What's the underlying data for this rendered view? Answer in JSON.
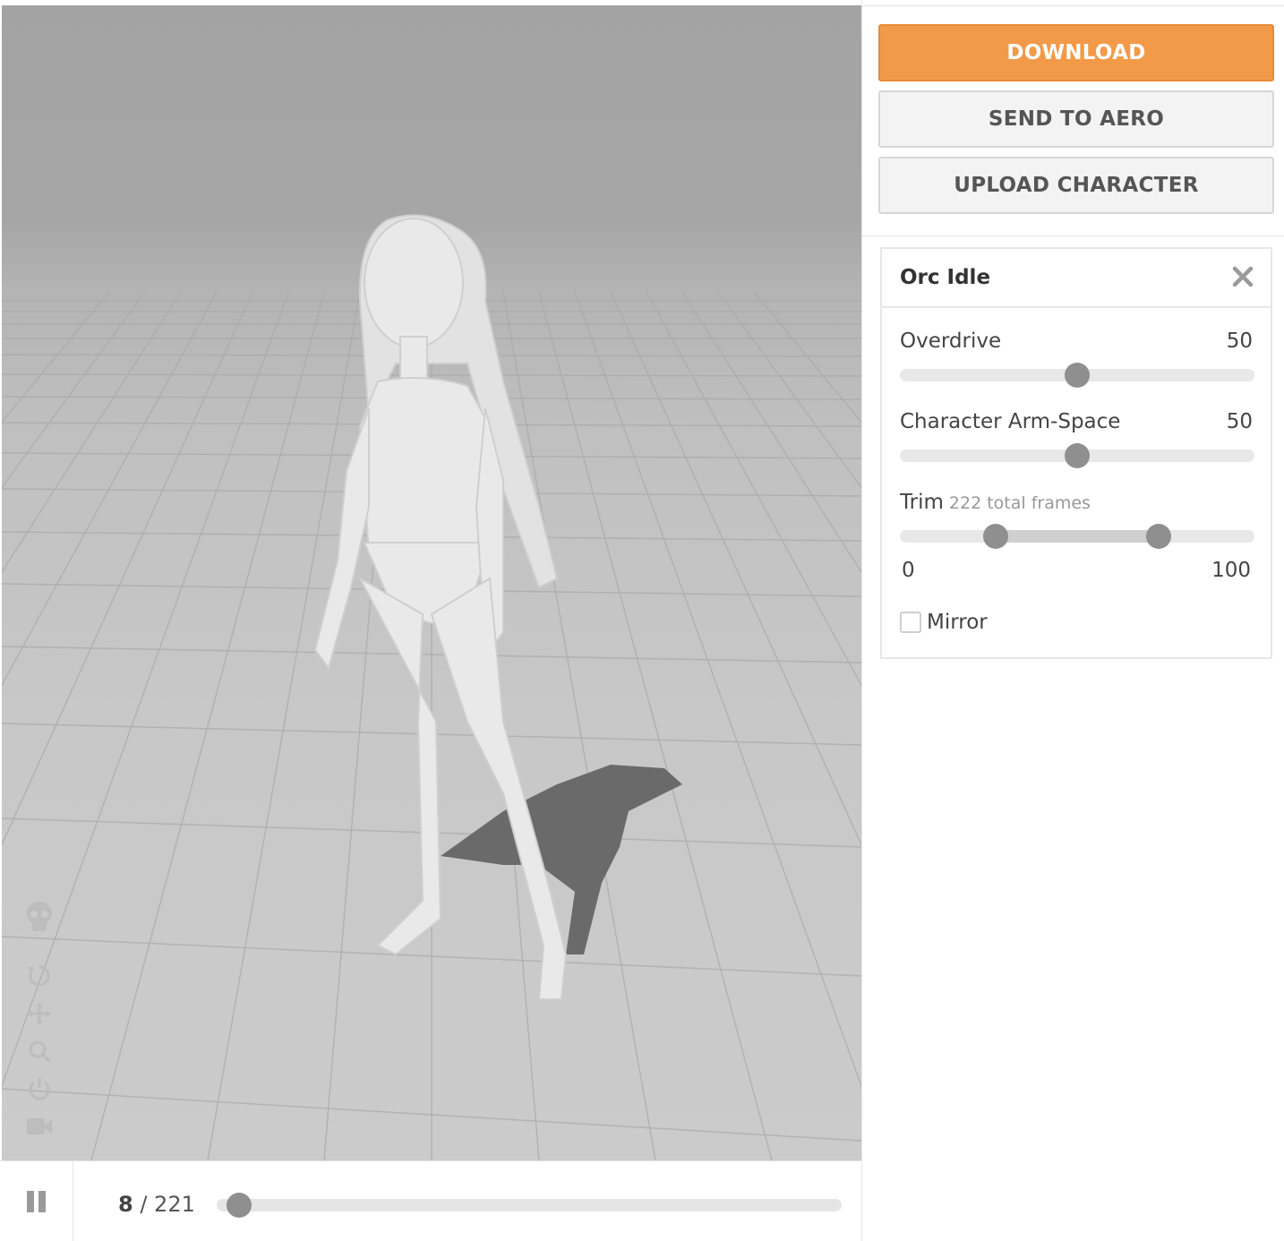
{
  "actions": {
    "download": "DOWNLOAD",
    "send_to_aero": "SEND TO AERO",
    "upload_character": "UPLOAD CHARACTER"
  },
  "animation_card": {
    "title": "Orc Idle",
    "close_icon": "close-icon",
    "sliders": [
      {
        "label": "Overdrive",
        "value": "50",
        "percent": 50
      },
      {
        "label": "Character Arm-Space",
        "value": "50",
        "percent": 50
      }
    ],
    "trim": {
      "label": "Trim",
      "sublabel": "222 total frames",
      "min_label": "0",
      "max_label": "100",
      "start_percent": 27,
      "end_percent": 73
    },
    "mirror": {
      "label": "Mirror",
      "checked": false
    }
  },
  "viewport_tools": [
    "skeleton-icon",
    "reset-icon",
    "move-icon",
    "zoom-icon",
    "power-icon",
    "camera-icon"
  ],
  "playback": {
    "state_icon": "pause-icon",
    "current_frame": "8",
    "separator": " / ",
    "total_frames": "221",
    "progress_percent": 3.6
  },
  "colors": {
    "accent": "#f29a48",
    "knob": "#8f8f8f"
  }
}
